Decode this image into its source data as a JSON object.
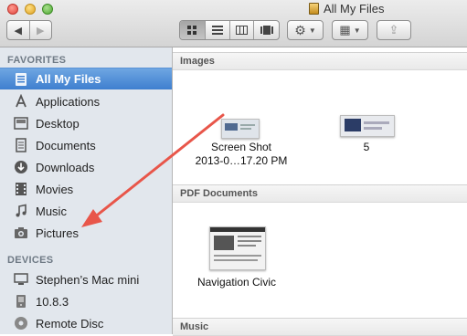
{
  "window": {
    "title": "All My Files",
    "controls": [
      "close",
      "minimize",
      "zoom"
    ]
  },
  "toolbar": {
    "nav": [
      "back-arrow-icon",
      "forward-arrow-icon"
    ],
    "view_modes": [
      "icon-view-icon",
      "list-view-icon",
      "column-view-icon",
      "coverflow-view-icon"
    ],
    "active_view": "icon",
    "action_label": "⚙",
    "arrange_label": "▦",
    "share_label": "⇪"
  },
  "sidebar": {
    "favorites_header": "FAVORITES",
    "favorites": [
      {
        "label": "All My Files",
        "icon": "all-my-files-icon",
        "selected": true
      },
      {
        "label": "Applications",
        "icon": "applications-icon"
      },
      {
        "label": "Desktop",
        "icon": "desktop-icon"
      },
      {
        "label": "Documents",
        "icon": "documents-icon"
      },
      {
        "label": "Downloads",
        "icon": "downloads-icon"
      },
      {
        "label": "Movies",
        "icon": "movies-icon"
      },
      {
        "label": "Music",
        "icon": "music-icon"
      },
      {
        "label": "Pictures",
        "icon": "pictures-icon"
      }
    ],
    "devices_header": "DEVICES",
    "devices": [
      {
        "label": "Stephen’s Mac mini",
        "icon": "computer-icon"
      },
      {
        "label": "10.8.3",
        "icon": "hard-drive-icon"
      },
      {
        "label": "Remote Disc",
        "icon": "disc-icon"
      }
    ]
  },
  "content": {
    "groups": [
      {
        "header": "Images",
        "files": [
          {
            "name_line1": "Screen Shot",
            "name_line2": "2013-0…17.20 PM"
          },
          {
            "name_line1": "5",
            "name_line2": ""
          }
        ]
      },
      {
        "header": "PDF Documents",
        "files": [
          {
            "name_line1": "Navigation Civic",
            "name_line2": ""
          }
        ]
      },
      {
        "header": "Music",
        "files": []
      }
    ]
  },
  "colors": {
    "selection": "#3f7fcf",
    "sidebar_bg": "#e2e7ed",
    "annotation_arrow": "#e8564a"
  }
}
